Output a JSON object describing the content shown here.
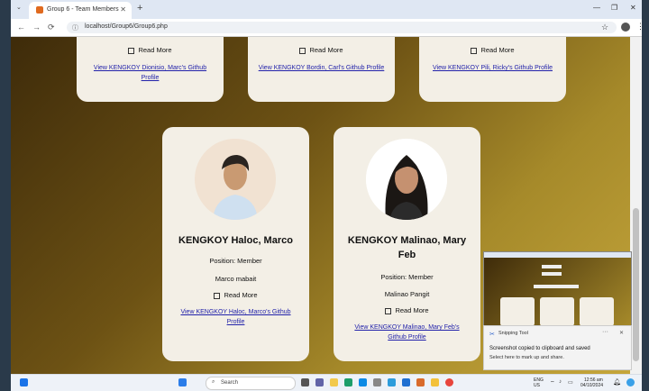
{
  "browser": {
    "tab_title": "Group 6 - Team Members",
    "new_tab": "+",
    "url": "localhost/Group6/Group6.php",
    "win_min": "—",
    "win_max": "❐",
    "win_close": "✕"
  },
  "cards_top": [
    {
      "read_more": "Read More",
      "github": "View KENGKOY Dionisio, Marc's Github Profile"
    },
    {
      "read_more": "Read More",
      "github": "View KENGKOY Bordin, Carl's Github Profile"
    },
    {
      "read_more": "Read More",
      "github": "View KENGKOY Pili, Ricky's Github Profile"
    }
  ],
  "cards": [
    {
      "name": "KENGKOY Haloc, Marco",
      "position": "Position: Member",
      "quote": "Marco mabait",
      "read_more": "Read More",
      "github": "View KENGKOY Haloc, Marco's Github Profile"
    },
    {
      "name": "KENGKOY Malinao, Mary Feb",
      "position": "Position: Member",
      "quote": "Malinao Pangit",
      "read_more": "Read More",
      "github": "View KENGKOY Malinao, Mary Feb's Github Profile"
    }
  ],
  "snipping": {
    "app": "Snipping Tool",
    "title": "Screenshot copied to clipboard and saved",
    "body": "Select here to mark up and share.",
    "more": "···",
    "close": "✕"
  },
  "taskbar": {
    "search": "Search",
    "lang_top": "ENG",
    "lang_bottom": "US",
    "time": "12:56 am",
    "date": "04/10/2024"
  }
}
